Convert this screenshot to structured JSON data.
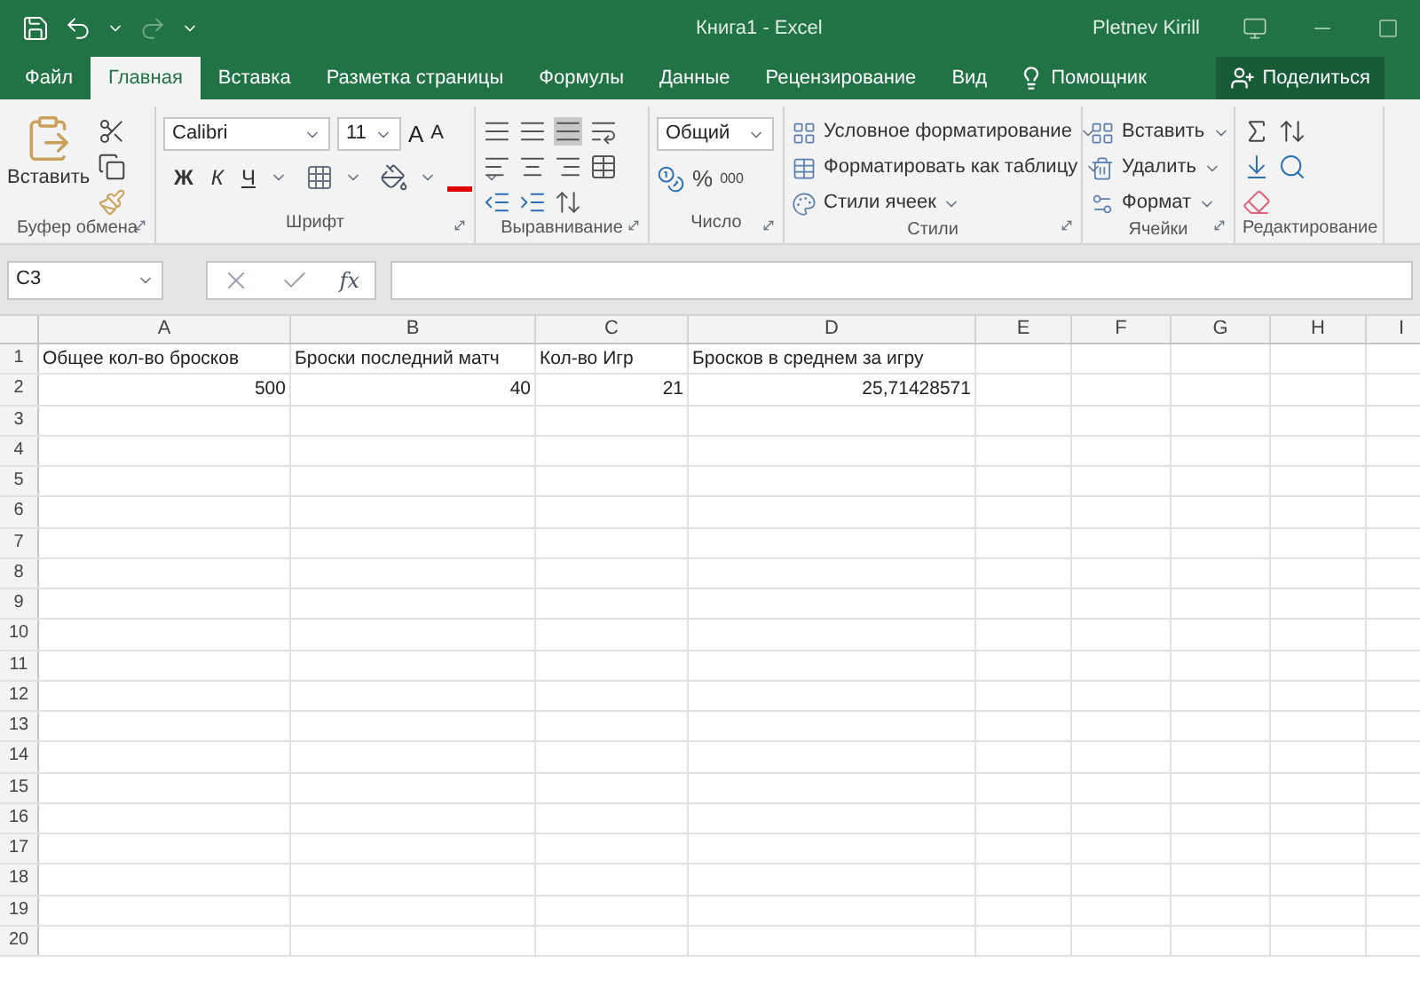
{
  "title_bar": {
    "title": "Книга1 - Excel",
    "user": "Pletnev Kirill"
  },
  "tabs": [
    {
      "label": "Файл",
      "selected": false
    },
    {
      "label": "Главная",
      "selected": true
    },
    {
      "label": "Вставка",
      "selected": false
    },
    {
      "label": "Разметка страницы",
      "selected": false
    },
    {
      "label": "Формулы",
      "selected": false
    },
    {
      "label": "Данные",
      "selected": false
    },
    {
      "label": "Рецензирование",
      "selected": false
    },
    {
      "label": "Вид",
      "selected": false
    }
  ],
  "assistant": "Помощник",
  "share": "Поделиться",
  "ribbon": [
    {
      "kind": "clipboard",
      "label": "Буфер обмена",
      "paste": "Вставить"
    },
    {
      "kind": "font",
      "label": "Шрифт",
      "font": "Calibri",
      "size": "11",
      "grow": "A",
      "shrink": "A",
      "bold": "Ж",
      "italic": "К",
      "underline": "Ч"
    },
    {
      "kind": "alignment",
      "label": "Выравнивание"
    },
    {
      "kind": "number",
      "label": "Число",
      "format": "Общий",
      "percent": "%",
      "thousands": "000"
    },
    {
      "kind": "styles",
      "label": "Стили",
      "commands": [
        "Условное форматирование",
        "Форматировать как таблицу",
        "Стили ячеек"
      ]
    },
    {
      "kind": "cells",
      "label": "Ячейки",
      "commands": [
        "Вставить",
        "Удалить",
        "Формат"
      ]
    },
    {
      "kind": "editing",
      "label": "Редактирование"
    }
  ],
  "formula_bar": {
    "name_box": "C3",
    "fx": "fx"
  },
  "sheet": {
    "columns": [
      "A",
      "B",
      "C",
      "D",
      "E",
      "F",
      "G",
      "H",
      "I"
    ],
    "rows": [
      {
        "number": "1",
        "cells": [
          {
            "kind": "text",
            "text": "Общее кол-во бросков"
          },
          {
            "kind": "text",
            "text": "Броски последний матч"
          },
          {
            "kind": "text",
            "text": "Кол-во Игр"
          },
          {
            "kind": "text",
            "text": "Бросков в среднем за игру"
          }
        ]
      },
      {
        "number": "2",
        "cells": [
          {
            "kind": "number",
            "text": "500"
          },
          {
            "kind": "number",
            "text": "40"
          },
          {
            "kind": "number",
            "text": "21"
          },
          {
            "kind": "number",
            "text": "25,71428571"
          }
        ]
      },
      {
        "number": "3",
        "cells": []
      },
      {
        "number": "4",
        "cells": []
      },
      {
        "number": "5",
        "cells": []
      },
      {
        "number": "6",
        "cells": []
      },
      {
        "number": "7",
        "cells": []
      },
      {
        "number": "8",
        "cells": []
      },
      {
        "number": "9",
        "cells": []
      },
      {
        "number": "10",
        "cells": []
      },
      {
        "number": "11",
        "cells": []
      },
      {
        "number": "12",
        "cells": []
      },
      {
        "number": "13",
        "cells": []
      },
      {
        "number": "14",
        "cells": []
      },
      {
        "number": "15",
        "cells": []
      },
      {
        "number": "16",
        "cells": []
      },
      {
        "number": "17",
        "cells": []
      },
      {
        "number": "18",
        "cells": []
      },
      {
        "number": "19",
        "cells": []
      },
      {
        "number": "20",
        "cells": []
      }
    ]
  }
}
